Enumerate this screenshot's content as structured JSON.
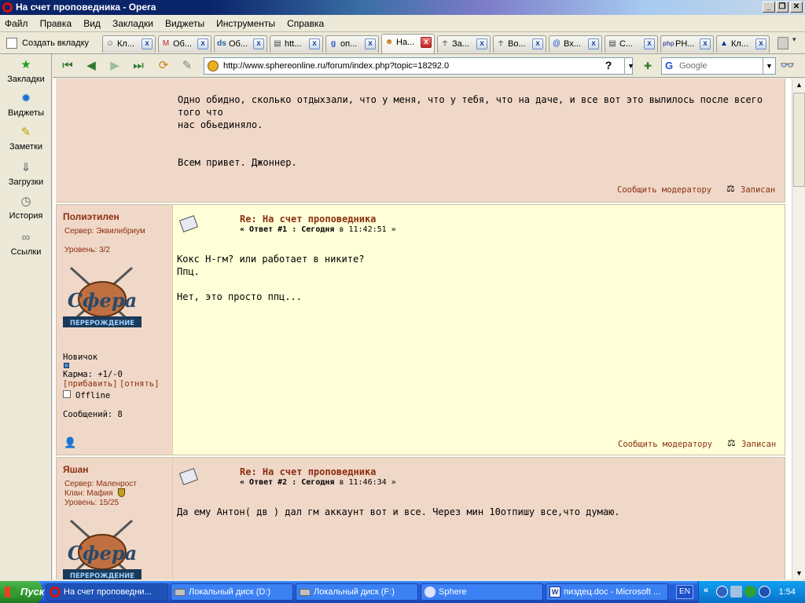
{
  "window": {
    "title": "На счет проповедника - Opera"
  },
  "menu": [
    "Файл",
    "Правка",
    "Вид",
    "Закладки",
    "Виджеты",
    "Инструменты",
    "Справка"
  ],
  "tabs": {
    "new_tab_label": "Создать вкладку",
    "items": [
      {
        "label": "Кл..."
      },
      {
        "label": "Об..."
      },
      {
        "label": "Об..."
      },
      {
        "label": "htt..."
      },
      {
        "label": "оп..."
      },
      {
        "label": "На..."
      },
      {
        "label": "За..."
      },
      {
        "label": "Во..."
      },
      {
        "label": "Вх..."
      },
      {
        "label": "С..."
      },
      {
        "label": "PH..."
      },
      {
        "label": "Кл..."
      }
    ]
  },
  "panel": {
    "items": [
      "Закладки",
      "Виджеты",
      "Заметки",
      "Загрузки",
      "История",
      "Ссылки"
    ]
  },
  "toolbar": {
    "address": "http://www.sphereonline.ru/forum/index.php?topic=18292.0",
    "help": "?",
    "search_placeholder": "Google",
    "search_engine_glyph": "G"
  },
  "posts": {
    "first": {
      "text1": "Одно обидно, сколько отдыхзали, что у меня, что у тебя, что на даче, и все вот это вылилось после всего того что",
      "text2": "нас обьединяло.",
      "text3": "Всем привет. Джоннер.",
      "report": "Сообщить модератору",
      "logged": "Записан"
    },
    "second": {
      "author": "Полиэтилен",
      "server": "Сервер: Эквилибриум",
      "level": "Уровень: 3/2",
      "rank": "Новичок",
      "karma": "Карма: +1/-0",
      "karma_add": "[прибавить]",
      "karma_sub": "[отнять]",
      "status": "Offline",
      "messages": "Сообщений: 8",
      "subject": "Re: На счет проповедника",
      "reply_prefix": "« Ответ #1 : Сегодня",
      "reply_time": " в 11:42:51 »",
      "line1": "Кокс Н-гм? или работает в никите?",
      "line2": "Ппц.",
      "line3": "Нет, это просто ппц...",
      "report": "Сообщить модератору",
      "logged": "Записан"
    },
    "third": {
      "author": "Яшан",
      "server": "Сервер: Маленрост",
      "clan": "Клан: Мафия",
      "level": "Уровень: 15/25",
      "subject": "Re: На счет проповедника",
      "reply_prefix": "« Ответ #2 : Сегодня",
      "reply_time": " в 11:46:34 »",
      "line1": "Да ему Антон( дв ) дал гм аккаунт вот и все. Через мин 10отпишу все,что думаю."
    },
    "avatar_line1": "Сфера",
    "avatar_line2": "ПЕРЕРОЖДЕНИЕ"
  },
  "taskbar": {
    "start": "Пуск",
    "tasks": [
      "На счет проповедни...",
      "Локальный диск (D:)",
      "Локальный диск (F:)",
      "Sphere",
      "пиздец.doc - Microsoft ..."
    ],
    "lang": "EN",
    "clock": "1:54"
  },
  "colors": {
    "post_pink": "#F0D8C8",
    "post_yellow": "#FFFFD8",
    "link_brown": "#8B2E10",
    "taskbar_blue": "#245EDB"
  }
}
